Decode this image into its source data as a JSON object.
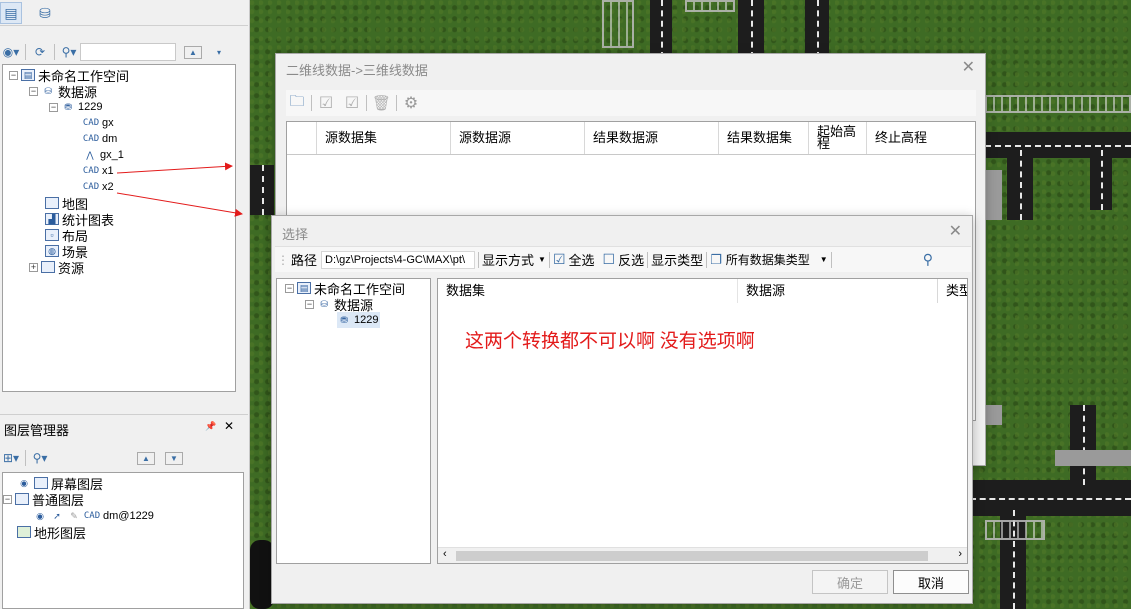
{
  "workspace_panel": {
    "tree": {
      "workspace": "未命名工作空间",
      "datasources": "数据源",
      "datasource_1229": "1229",
      "datasets": [
        {
          "icon": "cad-icon",
          "name": "gx"
        },
        {
          "icon": "cad-icon",
          "name": "dm"
        },
        {
          "icon": "line-dataset-icon",
          "name": "gx_1"
        },
        {
          "icon": "cad-icon",
          "name": "x1"
        },
        {
          "icon": "cad-icon",
          "name": "x2"
        }
      ],
      "maps": "地图",
      "charts": "统计图表",
      "layouts": "布局",
      "scenes": "场景",
      "resources": "资源"
    }
  },
  "layer_manager": {
    "title": "图层管理器",
    "pin_glyph": "📌",
    "close_glyph": "✕",
    "screen_layers": "屏幕图层",
    "normal_layers": "普通图层",
    "layer_item": "dm@1229",
    "cad_label": "CAD",
    "terrain_layers": "地形图层"
  },
  "convert_dialog": {
    "title": "二维线数据->三维线数据",
    "columns": [
      "源数据集",
      "源数据源",
      "结果数据源",
      "结果数据集",
      "起始高程",
      "终止高程"
    ]
  },
  "select_dialog": {
    "title": "选择",
    "path_label": "路径",
    "path_value": "D:\\gz\\Projects\\4-GC\\MAX\\pt\\",
    "display_mode": "显示方式",
    "select_all": "全选",
    "invert": "反选",
    "display_type_label": "显示类型",
    "dataset_type": "所有数据集类型",
    "tree": {
      "workspace": "未命名工作空间",
      "datasources": "数据源",
      "datasource_1229": "1229"
    },
    "columns": [
      "数据集",
      "数据源",
      "类型"
    ],
    "ok": "确定",
    "cancel": "取消"
  },
  "annotation": "这两个转换都不可以啊    没有选项啊",
  "colors": {
    "annotation_red": "#e31b1b",
    "accent_blue": "#3a6ea5",
    "grass": "#3e6b24"
  }
}
